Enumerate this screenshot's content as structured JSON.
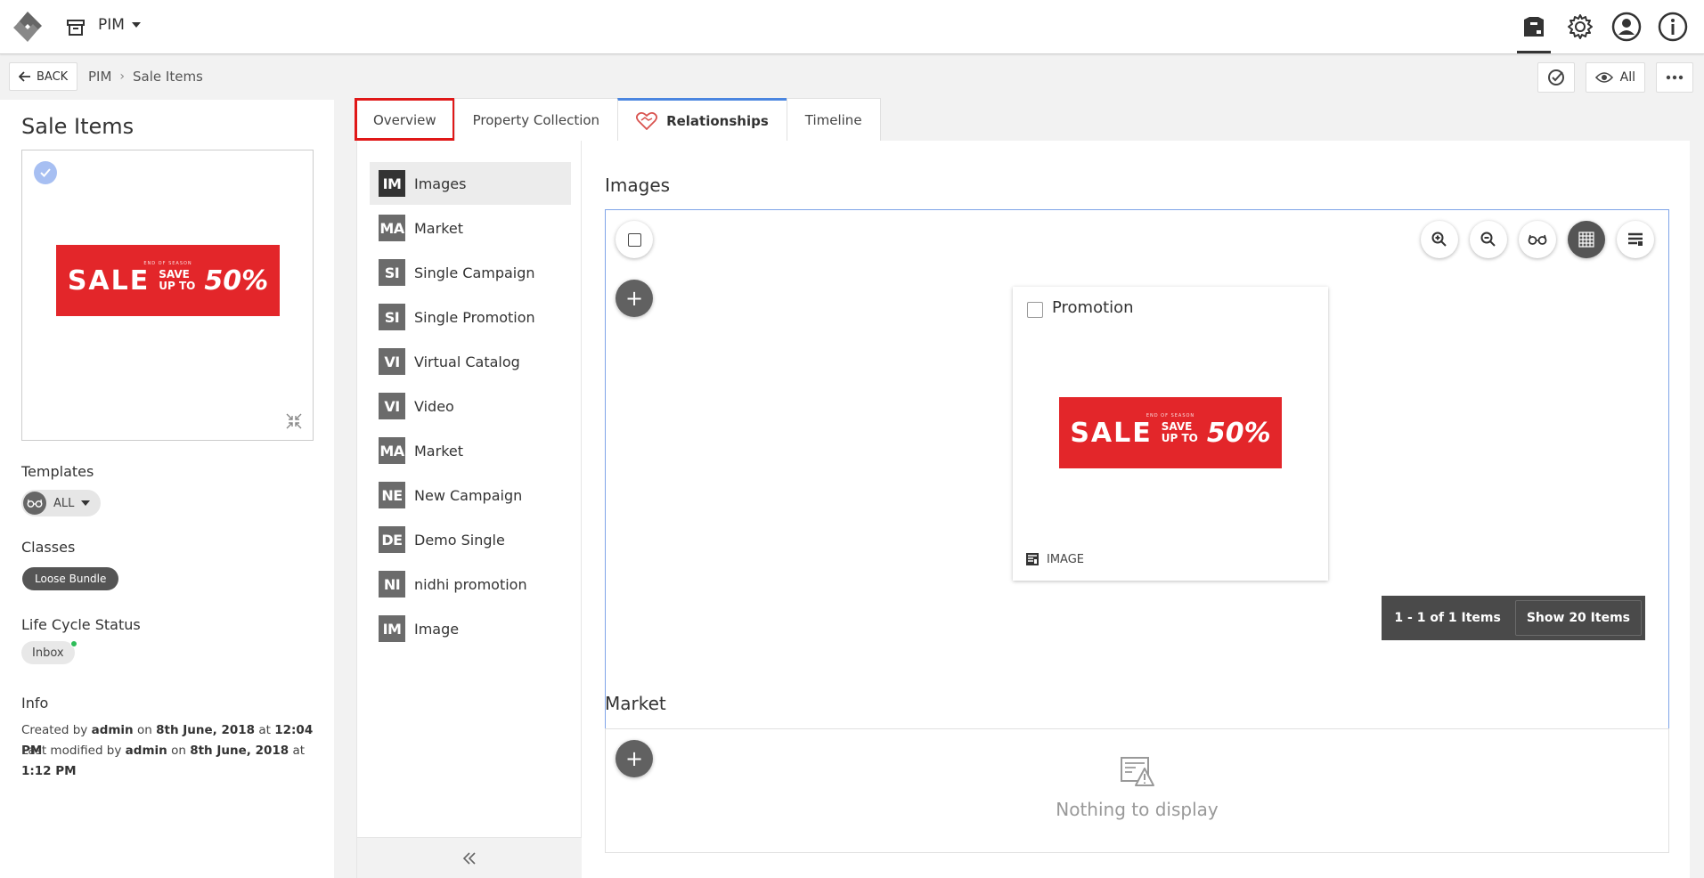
{
  "topbar": {
    "app_name": "PIM",
    "icons": [
      "dashboard-icon",
      "gear-icon",
      "user-icon",
      "info-icon"
    ]
  },
  "subbar": {
    "back_label": "BACK",
    "breadcrumb": [
      "PIM",
      "Sale Items"
    ],
    "view_label": "All"
  },
  "entity": {
    "title": "Sale Items",
    "templates_label": "Templates",
    "templates_value": "ALL",
    "classes_label": "Classes",
    "class_value": "Loose Bundle",
    "lifecycle_label": "Life Cycle Status",
    "lifecycle_value": "Inbox",
    "info_label": "Info",
    "created_prefix": "Created by",
    "created_by": "admin",
    "created_on_word": "on",
    "created_date": "8th June, 2018",
    "created_at_word": "at",
    "created_time": "12:04 PM",
    "modified_prefix": "Last modified by",
    "modified_by": "admin",
    "modified_on_word": "on",
    "modified_date": "8th June, 2018",
    "modified_at_word": "at",
    "modified_time": "1:12 PM"
  },
  "banner": {
    "small_text": "END OF SEASON",
    "sale": "SALE",
    "save_line1": "SAVE",
    "save_line2": "UP TO",
    "percent": "50%"
  },
  "tabs": [
    {
      "label": "Overview"
    },
    {
      "label": "Property Collection"
    },
    {
      "label": "Relationships"
    },
    {
      "label": "Timeline"
    }
  ],
  "relationships": [
    {
      "abbr": "IM",
      "label": "Images"
    },
    {
      "abbr": "MA",
      "label": "Market"
    },
    {
      "abbr": "SI",
      "label": "Single Campaign"
    },
    {
      "abbr": "SI",
      "label": "Single Promotion"
    },
    {
      "abbr": "VI",
      "label": "Virtual Catalog"
    },
    {
      "abbr": "VI",
      "label": "Video"
    },
    {
      "abbr": "MA",
      "label": "Market"
    },
    {
      "abbr": "NE",
      "label": "New Campaign"
    },
    {
      "abbr": "DE",
      "label": "Demo Single"
    },
    {
      "abbr": "NI",
      "label": "nidhi promotion"
    },
    {
      "abbr": "IM",
      "label": "Image"
    }
  ],
  "images_section": {
    "title": "Images",
    "card_title": "Promotion",
    "card_type": "IMAGE",
    "pager_text": "1 - 1 of 1 Items",
    "pager_show": "Show 20 Items"
  },
  "market_section": {
    "title": "Market",
    "empty_text": "Nothing to display"
  },
  "colors": {
    "accent": "#4b86e0",
    "sale_red": "#e3262a",
    "highlight_red": "#e01818",
    "status_green": "#2ebd59"
  }
}
